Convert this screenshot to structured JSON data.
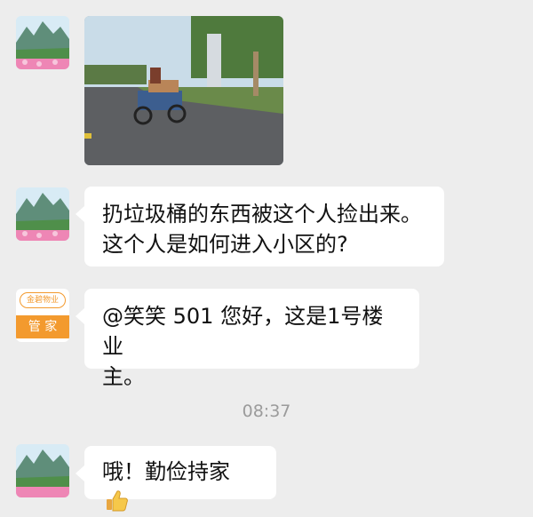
{
  "messages": [
    {
      "type": "image",
      "sender_avatar": "landscape-avatar"
    },
    {
      "type": "text",
      "sender_avatar": "landscape-avatar",
      "lines": [
        "扔垃圾桶的东西被这个人捡出来。",
        "这个人是如何进入小区的?"
      ]
    },
    {
      "type": "text",
      "sender_avatar": "property-manager-avatar",
      "lines": [
        "@笑笑 501 您好，这是1号楼业",
        "主。"
      ]
    },
    {
      "type": "text",
      "sender_avatar": "landscape-avatar",
      "text": "哦！勤俭持家",
      "emoji": "thumbs-up"
    }
  ],
  "timestamp": "08:37",
  "manager_avatar": {
    "brand": "金碧物业",
    "label": "管 家"
  },
  "colors": {
    "bubble": "#ffffff",
    "background": "#ededed",
    "manager_orange": "#f39a2e"
  }
}
